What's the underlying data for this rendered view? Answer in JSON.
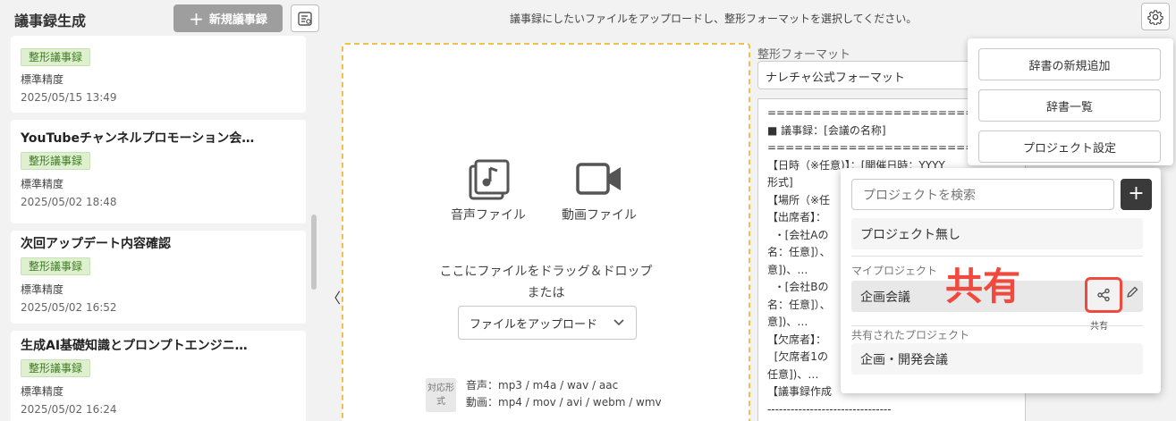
{
  "header": {
    "title": "議事録生成",
    "new_button": "新規議事録",
    "instruction": "議事録にしたいファイルをアップロードし、整形フォーマットを選択してください。"
  },
  "records": [
    {
      "title": "",
      "tag": "整形議事録",
      "accuracy": "標準精度",
      "date": "2025/05/15 13:49"
    },
    {
      "title": "YouTubeチャンネルプロモーション会…",
      "tag": "整形議事録",
      "accuracy": "標準精度",
      "date": "2025/05/02 18:48"
    },
    {
      "title": "次回アップデート内容確認",
      "tag": "整形議事録",
      "accuracy": "標準精度",
      "date": "2025/05/02 16:52"
    },
    {
      "title": "生成AI基礎知識とプロンプトエンジニ…",
      "tag": "整形議事録",
      "accuracy": "標準精度",
      "date": "2025/05/02 16:24"
    }
  ],
  "collapse_arrow": "〈",
  "upload": {
    "audio_label": "音声ファイル",
    "video_label": "動画ファイル",
    "drop_line1": "ここにファイルをドラッグ＆ドロップ",
    "drop_line2": "または",
    "select_label": "ファイルをアップロード",
    "formats_tag": "対応形式",
    "audio_formats": "音声：mp3 / m4a / wav / aac",
    "video_formats": "動画：mp4 / mov / avi / webm / wmv"
  },
  "format": {
    "label": "整形フォーマット",
    "selected": "ナレチャ公式フォーマット",
    "preview_lines": [
      "================================",
      "■ 議事録：[会議の名称]",
      "================================",
      "【日時（※任意)】：[開催日時：YYYY",
      "形式]",
      "【場所（※任",
      "【出席者】：",
      "  ・[会社Aの",
      "名：任意]）、",
      "意])、…",
      "  ・[会社Bの",
      "名：任意]）、",
      "意])、…",
      "【欠席者】：",
      "  [欠席者1の",
      "任意])、…",
      "【議事録作成",
      "",
      "--------------------------------"
    ]
  },
  "settings_menu": {
    "items": [
      "辞書の新規追加",
      "辞書一覧",
      "プロジェクト設定"
    ]
  },
  "projects": {
    "search_placeholder": "プロジェクトを検索",
    "add": "+",
    "none": "プロジェクト無し",
    "my_label": "マイプロジェクト",
    "my_items": [
      "企画会議"
    ],
    "shared_label": "共有されたプロジェクト",
    "shared_items": [
      "企画・開発会議"
    ],
    "share_tooltip": "共有",
    "annotation": "共有"
  },
  "colors": {
    "accent_red": "#f04a3e",
    "dashed_border": "#f0c04a",
    "tag_bg": "#dff0d0",
    "tag_text": "#3d7a21"
  }
}
